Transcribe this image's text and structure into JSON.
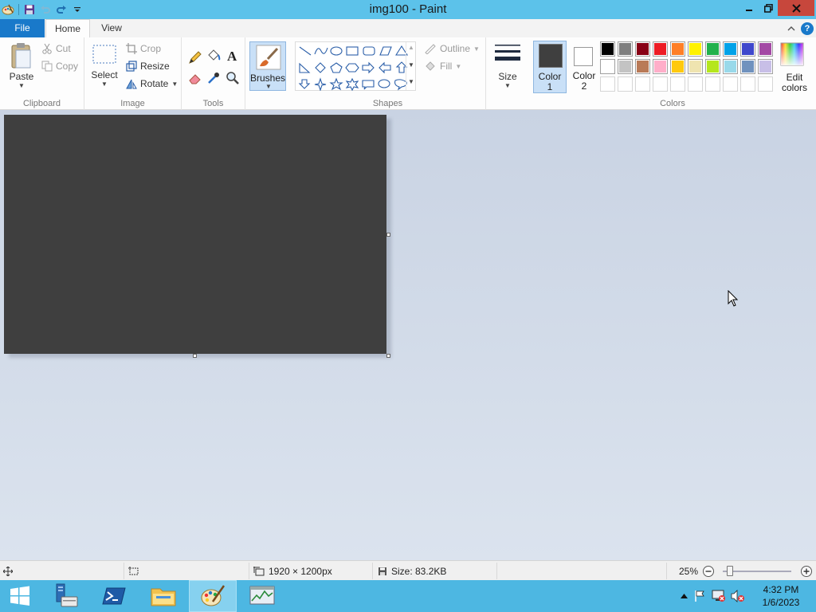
{
  "window": {
    "title": "img100 - Paint",
    "controls": {
      "minimize": "minimize-icon",
      "restore": "restore-icon",
      "close": "close-icon"
    }
  },
  "quick_access": [
    "paint-app-icon",
    "save-icon",
    "undo-icon",
    "redo-icon",
    "customize-dropdown-icon"
  ],
  "tabs": {
    "file": "File",
    "home": "Home",
    "view": "View"
  },
  "ribbon": {
    "clipboard": {
      "label": "Clipboard",
      "paste": "Paste",
      "cut": "Cut",
      "copy": "Copy"
    },
    "image": {
      "label": "Image",
      "select": "Select",
      "crop": "Crop",
      "resize": "Resize",
      "rotate": "Rotate"
    },
    "tools": {
      "label": "Tools"
    },
    "brushes": {
      "label": "Brushes"
    },
    "shapes": {
      "label": "Shapes",
      "outline": "Outline",
      "fill": "Fill"
    },
    "size": {
      "label": "Size"
    },
    "colors": {
      "label": "Colors",
      "color1": "Color 1",
      "color2": "Color 2",
      "edit": "Edit colors",
      "color1_value": "#3f3f3f",
      "color2_value": "#ffffff",
      "palette_row1": [
        "#000000",
        "#7f7f7f",
        "#880015",
        "#ed1c24",
        "#ff7f27",
        "#fff200",
        "#22b14c",
        "#00a2e8",
        "#3f48cc",
        "#a349a4"
      ],
      "palette_row2": [
        "#ffffff",
        "#c3c3c3",
        "#b97a57",
        "#ffaec9",
        "#ffc90e",
        "#efe4b0",
        "#b5e61d",
        "#99d9ea",
        "#7092be",
        "#c8bfe7"
      ]
    }
  },
  "canvas": {
    "fill_color": "#3f3f3f"
  },
  "status": {
    "dimensions": "1920 × 1200px",
    "size": "Size: 83.2KB",
    "zoom": "25%",
    "zoom_fraction": 0.1
  },
  "taskbar": {
    "items": [
      "start-icon",
      "server-manager-icon",
      "powershell-icon",
      "file-explorer-icon",
      "paint-icon",
      "task-manager-icon"
    ],
    "time": "4:32 PM",
    "date": "1/6/2023"
  }
}
